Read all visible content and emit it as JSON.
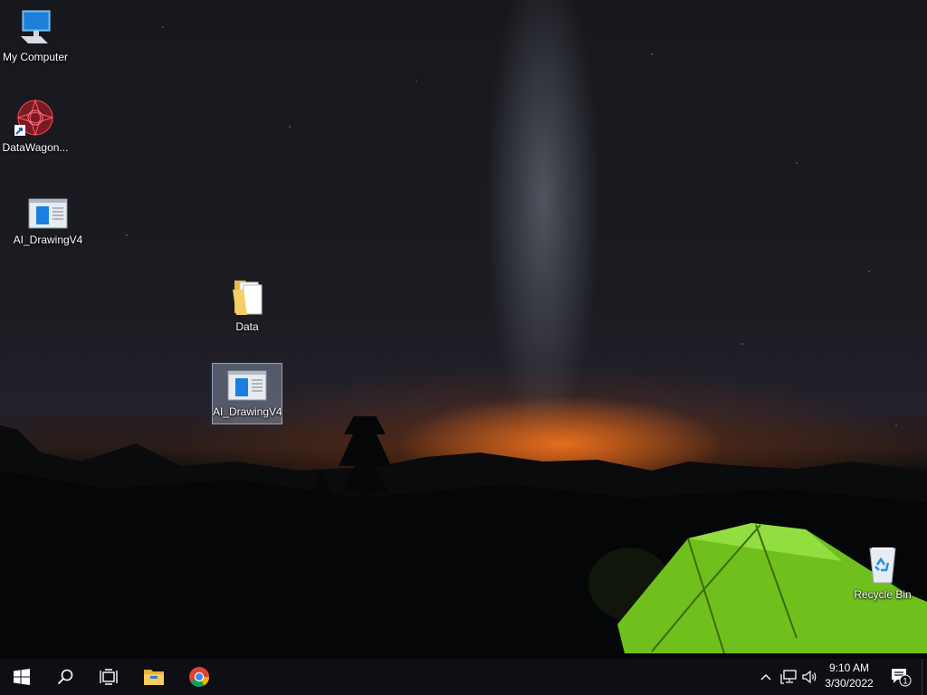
{
  "desktop": {
    "icons": [
      {
        "label": "My Computer",
        "icon": "computer-icon"
      },
      {
        "label": "DataWagon...",
        "icon": "datawagon-icon"
      },
      {
        "label": "AI_DrawingV4",
        "icon": "application-icon"
      },
      {
        "label": "Data",
        "icon": "folder-icon"
      },
      {
        "label": "AI_DrawingV4",
        "icon": "application-icon",
        "selected": true
      },
      {
        "label": "Recycle Bin",
        "icon": "recycle-bin-icon"
      }
    ]
  },
  "taskbar": {
    "buttons": [
      {
        "icon": "windows-start-icon"
      },
      {
        "icon": "search-icon"
      },
      {
        "icon": "task-view-icon"
      },
      {
        "icon": "file-explorer-icon"
      },
      {
        "icon": "chrome-icon"
      }
    ],
    "tray": {
      "icons": [
        "chevron-up-icon",
        "network-icon",
        "volume-icon"
      ],
      "time": "9:10 AM",
      "date": "3/30/2022",
      "notification_count": "1"
    }
  },
  "colors": {
    "taskbar": "#0d0f14",
    "tent": "#7fd321",
    "horizon_glow": "#ff7a1e",
    "selection": "#b4c8e6"
  }
}
